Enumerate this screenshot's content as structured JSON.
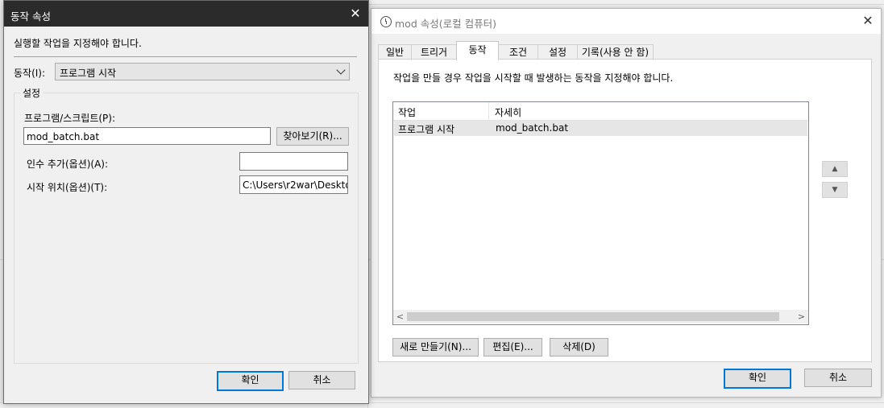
{
  "left_dialog": {
    "title": "동작 속성",
    "instruction": "실행할 작업을 지정해야 합니다.",
    "action_label": "동작(I):",
    "action_value": "프로그램 시작",
    "settings_group": "설정",
    "program_label": "프로그램/스크립트(P):",
    "program_value": "mod_batch.bat",
    "browse_button": "찾아보기(R)...",
    "args_label": "인수 추가(옵션)(A):",
    "args_value": "",
    "startin_label": "시작 위치(옵션)(T):",
    "startin_value": "C:\\Users\\r2war\\Deskto",
    "ok_button": "확인",
    "cancel_button": "취소"
  },
  "right_dialog": {
    "title": "mod 속성(로컬 컴퓨터)",
    "tabs": [
      "일반",
      "트리거",
      "동작",
      "조건",
      "설정",
      "기록(사용 안 함)"
    ],
    "active_tab": "동작",
    "description": "작업을 만들 경우 작업을 시작할 때 발생하는 동작을 지정해야 합니다.",
    "columns": [
      "작업",
      "자세히"
    ],
    "rows": [
      {
        "action": "프로그램 시작",
        "details": "mod_batch.bat"
      }
    ],
    "new_button": "새로 만들기(N)...",
    "edit_button": "편집(E)...",
    "delete_button": "삭제(D)",
    "ok_button": "확인",
    "cancel_button": "취소"
  },
  "icons": {
    "close": "close-icon",
    "up": "move-up-icon",
    "down": "move-down-icon",
    "dropdown": "chevron-down-icon",
    "title": "clock-icon"
  },
  "colors": {
    "left_titlebar": "#2b2b2b",
    "default_button_border": "#0078d7",
    "selected_row": "#e6e6e6"
  }
}
